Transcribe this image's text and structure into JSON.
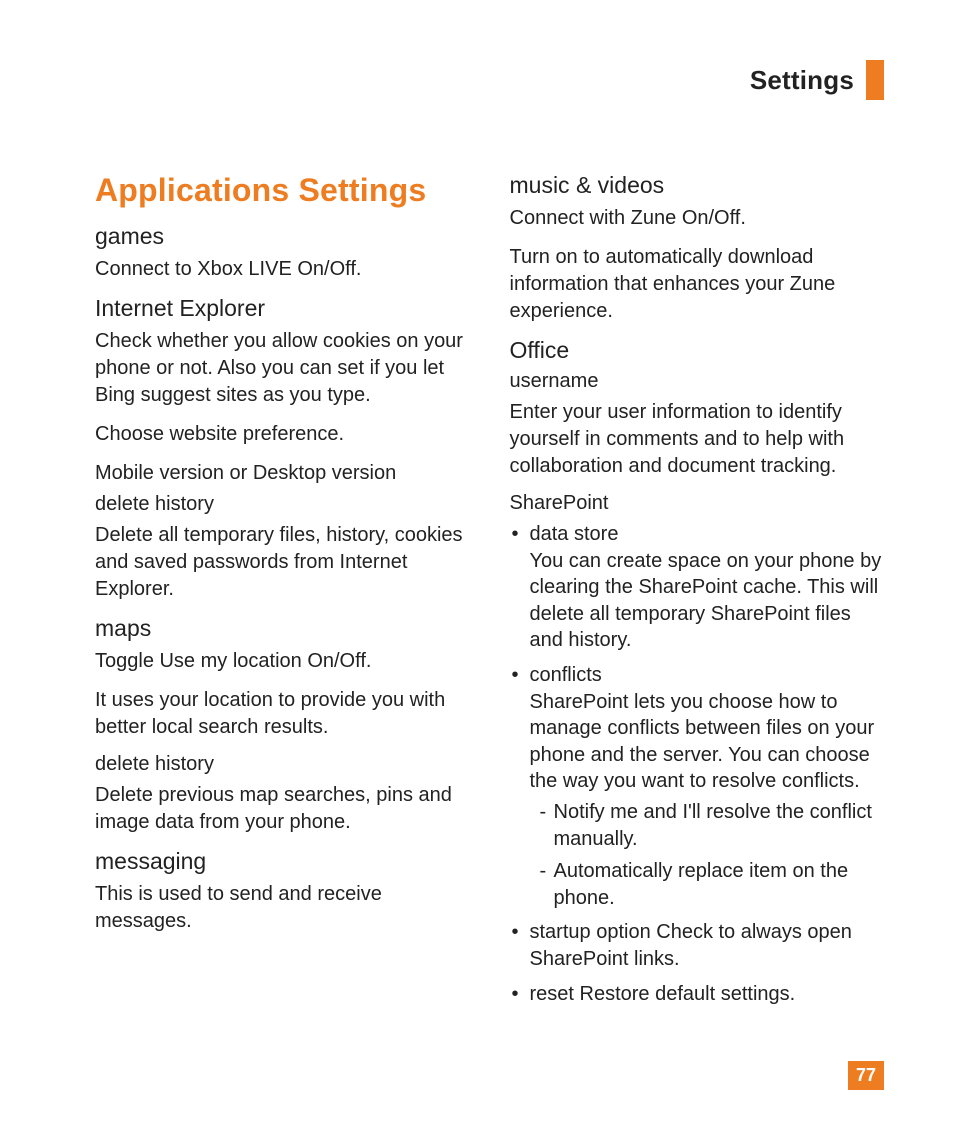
{
  "header": {
    "title": "Settings"
  },
  "pageNumber": "77",
  "left": {
    "sectionTitle": "Applications Settings",
    "games": {
      "heading": "games",
      "p1": "Connect to Xbox LIVE On/Off."
    },
    "ie": {
      "heading": "Internet Explorer",
      "p1": "Check whether you allow cookies on your phone or not. Also you can set if you let Bing suggest sites as you type.",
      "p2": "Choose website preference.",
      "p3": "Mobile version or Desktop version",
      "deleteHistoryHeading": "delete history",
      "p4": "Delete all temporary files, history, cookies and saved passwords from Internet Explorer."
    },
    "maps": {
      "heading": "maps",
      "p1": "Toggle Use my location On/Off.",
      "p2": "It uses your location to provide you with better local search results.",
      "deleteHistoryHeading": "delete history",
      "p3": "Delete previous map searches, pins and image data from your phone."
    },
    "messaging": {
      "heading": "messaging",
      "p1": "This is used to send and receive messages."
    }
  },
  "right": {
    "music": {
      "heading": "music & videos",
      "p1": "Connect with Zune On/Off.",
      "p2": "Turn on to automatically download information that enhances your Zune experience."
    },
    "office": {
      "heading": "Office",
      "usernameHeading": "username",
      "p1": "Enter your user information to identify yourself in comments and to help with collaboration and document tracking.",
      "sharepointHeading": "SharePoint",
      "bullets": {
        "b1title": "data store",
        "b1desc": "You can create space on your phone by clearing the SharePoint cache. This will delete all temporary SharePoint files and history.",
        "b2title": "conflicts",
        "b2desc": "SharePoint lets you choose how to manage conflicts between files on your phone and the server. You can choose the way you want to resolve conflicts.",
        "b2dash1": "Notify me and I'll resolve the conflict manually.",
        "b2dash2": "Automatically replace item on the phone.",
        "b3": "startup option Check to always open SharePoint links.",
        "b4": "reset Restore default settings."
      }
    }
  }
}
